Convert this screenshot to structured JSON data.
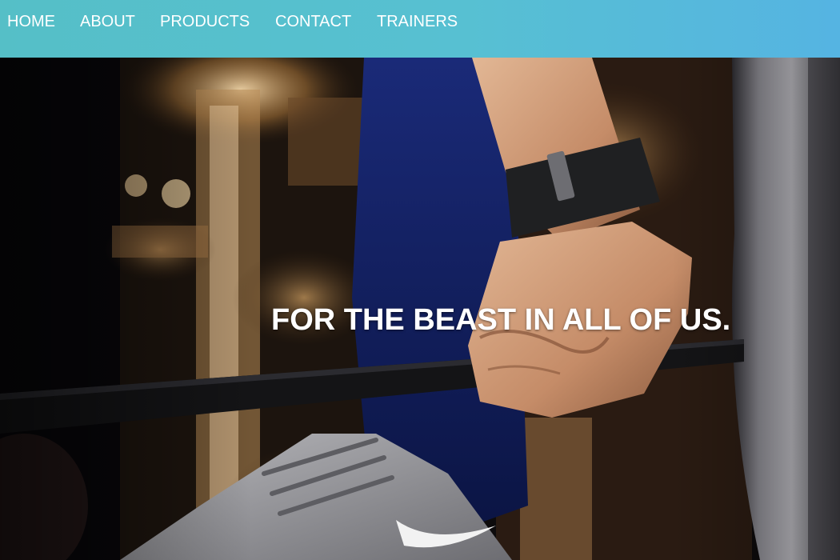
{
  "nav": {
    "items": [
      {
        "label": "HOME"
      },
      {
        "label": "ABOUT"
      },
      {
        "label": "PRODUCTS"
      },
      {
        "label": "CONTACT"
      },
      {
        "label": "TRAINERS"
      }
    ]
  },
  "hero": {
    "tagline": "FOR THE BEAST IN ALL OF US.",
    "image": "gym-deadlift-photo"
  },
  "colors": {
    "navbar_start": "#55bfc7",
    "navbar_end": "#55b4e2",
    "nav_text": "#ffffff",
    "tagline_text": "#ffffff"
  }
}
